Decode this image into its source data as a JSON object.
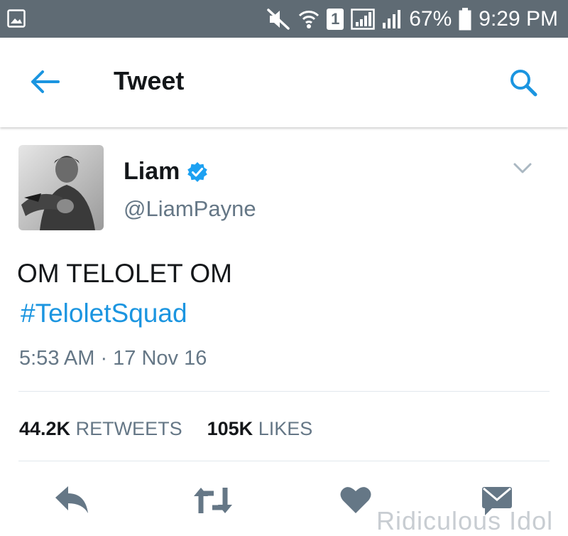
{
  "status_bar": {
    "battery": "67%",
    "time": "9:29 PM",
    "sim_slot": "1",
    "icons": [
      "gallery-notification-icon",
      "mute-icon",
      "wifi-icon",
      "sim-1-icon",
      "signal-icon",
      "signal-icon",
      "battery-icon"
    ]
  },
  "toolbar": {
    "title": "Tweet",
    "back_icon": "back-arrow-icon",
    "search_icon": "search-icon"
  },
  "tweet": {
    "author_name": "Liam",
    "handle": "@LiamPayne",
    "verified": true,
    "text": "OM TELOLET OM",
    "hashtag": "#TeloletSquad",
    "timestamp": "5:53 AM · 17 Nov 16",
    "stats": {
      "retweets_count": "44.2K",
      "retweets_label": "RETWEETS",
      "likes_count": "105K",
      "likes_label": "LIKES"
    }
  },
  "actions": [
    "reply-icon",
    "retweet-icon",
    "like-icon",
    "direct-message-icon"
  ],
  "colors": {
    "status_bar": "#5f6b74",
    "accent": "#1b95e0",
    "verified": "#1da1f2",
    "secondary_text": "#657786",
    "action_icon": "#657786",
    "divider": "#e1e8ed"
  },
  "watermark": "Ridiculous Idol"
}
